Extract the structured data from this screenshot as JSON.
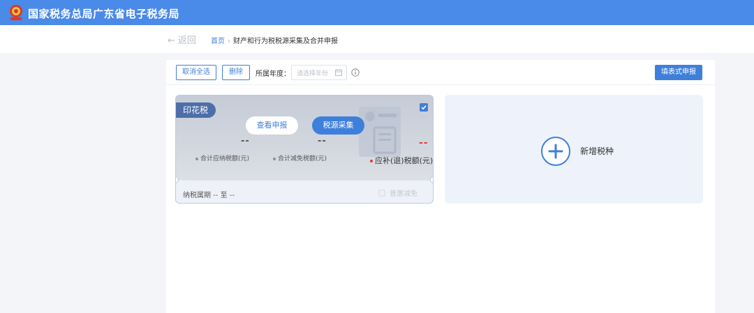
{
  "header": {
    "title": "国家税务总局广东省电子税务局"
  },
  "breadcrumb": {
    "back_label": "返回",
    "home": "首页",
    "separator": "›",
    "current": "财产和行为税税源采集及合并申报"
  },
  "toolbar": {
    "cancel_all_label": "取消全选",
    "delete_label": "删除",
    "year_label": "所属年度：",
    "year_placeholder": "请选择年份",
    "fill_declare_label": "填表式申报"
  },
  "tax_card": {
    "name": "印花税",
    "checked": true,
    "view_declare_label": "查看申报",
    "collect_label": "税源采集",
    "payable_value": "--",
    "payable_label": "合计应纳税额(元)",
    "relief_value": "--",
    "relief_label": "合计减免税额(元)",
    "refund_value": "--",
    "refund_label": "应补(退)税额(元)",
    "period_text": "纳税属期 -- 至 --",
    "inclusive_relief_label": "普惠减免"
  },
  "add_card": {
    "label": "新增税种"
  },
  "colors": {
    "header_bg": "#4a8ae8",
    "accent": "#3f7fdc",
    "danger": "#e23b3b",
    "tag_bg": "#4d6ea8"
  },
  "icons": {
    "emblem": "national-emblem-icon",
    "back": "arrow-left-icon",
    "calendar": "calendar-icon",
    "info": "info-icon",
    "check": "checkbox-checked-icon",
    "plus": "plus-icon"
  }
}
